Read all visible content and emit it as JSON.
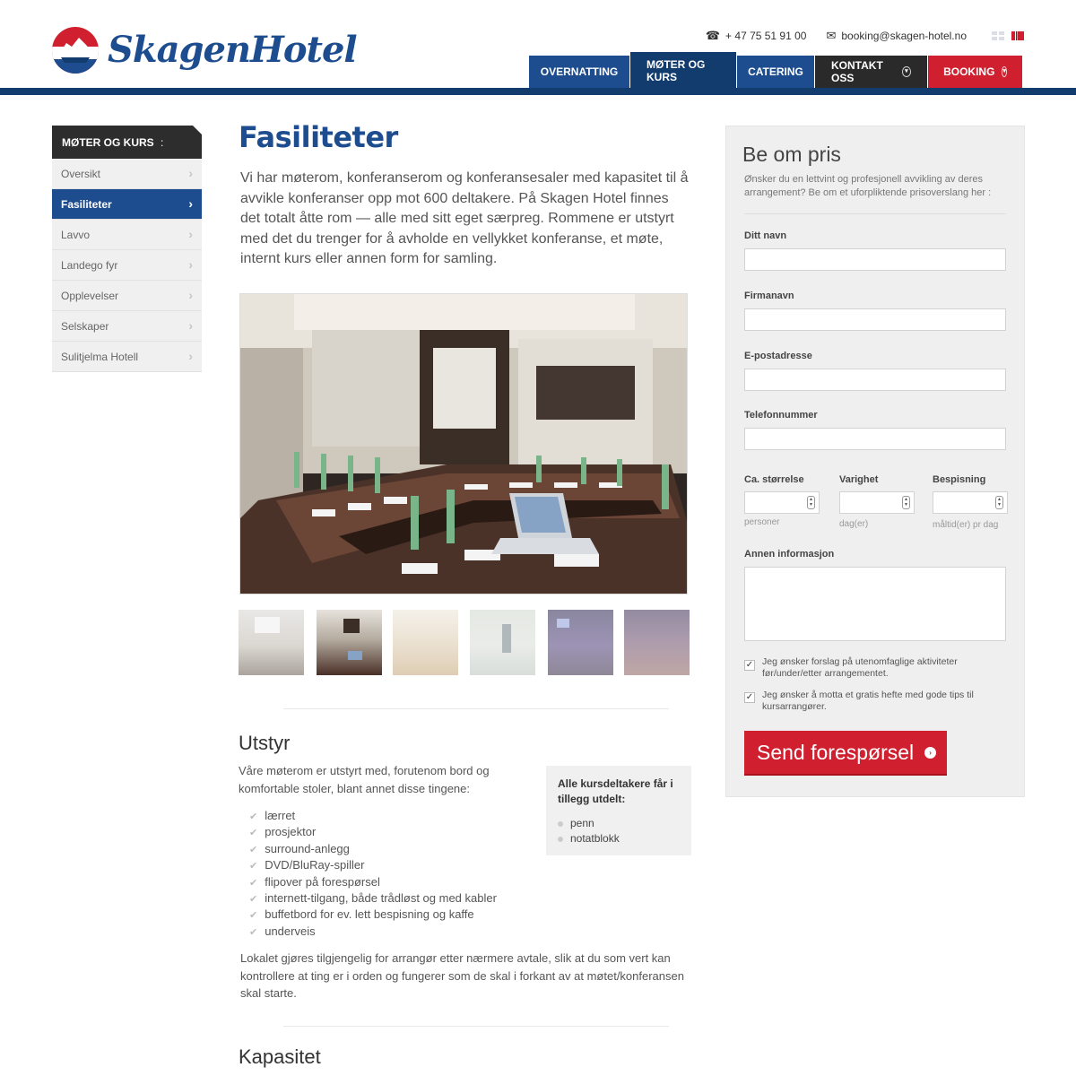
{
  "header": {
    "brand": "SkagenHotel",
    "phone": "+ 47 75 51 91 00",
    "email": "booking@skagen-hotel.no",
    "languages": [
      "English",
      "Norsk"
    ]
  },
  "nav": {
    "items": [
      {
        "label": "OVERNATTING"
      },
      {
        "label": "MØTER OG KURS"
      },
      {
        "label": "CATERING"
      },
      {
        "label": "KONTAKT OSS"
      },
      {
        "label": "BOOKING"
      }
    ],
    "active": "MØTER OG KURS"
  },
  "sidebar": {
    "title": "MØTER OG KURS",
    "items": [
      {
        "label": "Oversikt"
      },
      {
        "label": "Fasiliteter"
      },
      {
        "label": "Lavvo"
      },
      {
        "label": "Landego fyr"
      },
      {
        "label": "Opplevelser"
      },
      {
        "label": "Selskaper"
      },
      {
        "label": "Sulitjelma Hotell"
      }
    ],
    "active": "Fasiliteter"
  },
  "main": {
    "title": "Fasiliteter",
    "intro": "Vi har møterom, konferanserom og konferansesaler med kapasitet til å avvikle konferanser opp mot 600 deltakere. På Skagen Hotel finnes det totalt åtte rom — alle med sitt eget særpreg. Rommene er utstyrt med det du trenger for å avholde en vellykket konferanse, et møte, internt kurs eller annen form for samling.",
    "gallery": {
      "thumb_count": 6,
      "selected_index": 2
    },
    "utstyr": {
      "heading": "Utstyr",
      "intro": "Våre møterom er utstyrt med, forutenom bord og komfortable stoler, blant annet disse tingene:",
      "items": [
        "lærret",
        "prosjektor",
        "surround-anlegg",
        "DVD/BluRay-spiller",
        "flipover på forespørsel",
        "internett-tilgang, både trådløst og med kabler",
        "buffetbord for ev. lett bespisning og kaffe",
        "underveis"
      ],
      "infobox": {
        "title": "Alle kursdeltakere får i tillegg utdelt:",
        "items": [
          "penn",
          "notatblokk"
        ]
      },
      "outro": "Lokalet gjøres tilgjengelig for arrangør etter nærmere avtale, slik at du som vert kan kontrollere at ting er i orden og fungerer som de skal i forkant av at møtet/konferansen skal starte."
    },
    "kapasitet": {
      "heading": "Kapasitet"
    }
  },
  "form": {
    "title": "Be om pris",
    "description": "Ønsker du en lettvint og profesjonell avvikling av deres arrangement? Be om et uforpliktende prisoverslang her :",
    "fields": {
      "name": {
        "label": "Ditt navn",
        "value": ""
      },
      "company": {
        "label": "Firmanavn",
        "value": ""
      },
      "email": {
        "label": "E-postadresse",
        "value": ""
      },
      "phone": {
        "label": "Telefonnummer",
        "value": ""
      }
    },
    "size": {
      "label": "Ca. størrelse",
      "unit": "personer",
      "value": ""
    },
    "duration": {
      "label": "Varighet",
      "unit": "dag(er)",
      "value": ""
    },
    "meals": {
      "label": "Bespisning",
      "unit": "måltid(er) pr dag",
      "value": ""
    },
    "other": {
      "label": "Annen informasjon",
      "value": ""
    },
    "checkboxes": [
      {
        "label": "Jeg ønsker forslag på utenomfaglige aktiviteter før/under/etter arrangementet.",
        "checked": true
      },
      {
        "label": "Jeg ønsker å motta et gratis hefte med gode tips til kursarrangører.",
        "checked": true
      }
    ],
    "submit": "Send forespørsel"
  },
  "colors": {
    "brand_blue": "#1d4d8f",
    "dark_blue": "#123b6e",
    "red": "#d0202f",
    "dark": "#2a2a2a"
  },
  "icons": [
    "phone-icon",
    "mail-icon",
    "chevron-right-icon",
    "circle-chevron-down-icon",
    "check-icon",
    "circle-arrow-icon"
  ]
}
